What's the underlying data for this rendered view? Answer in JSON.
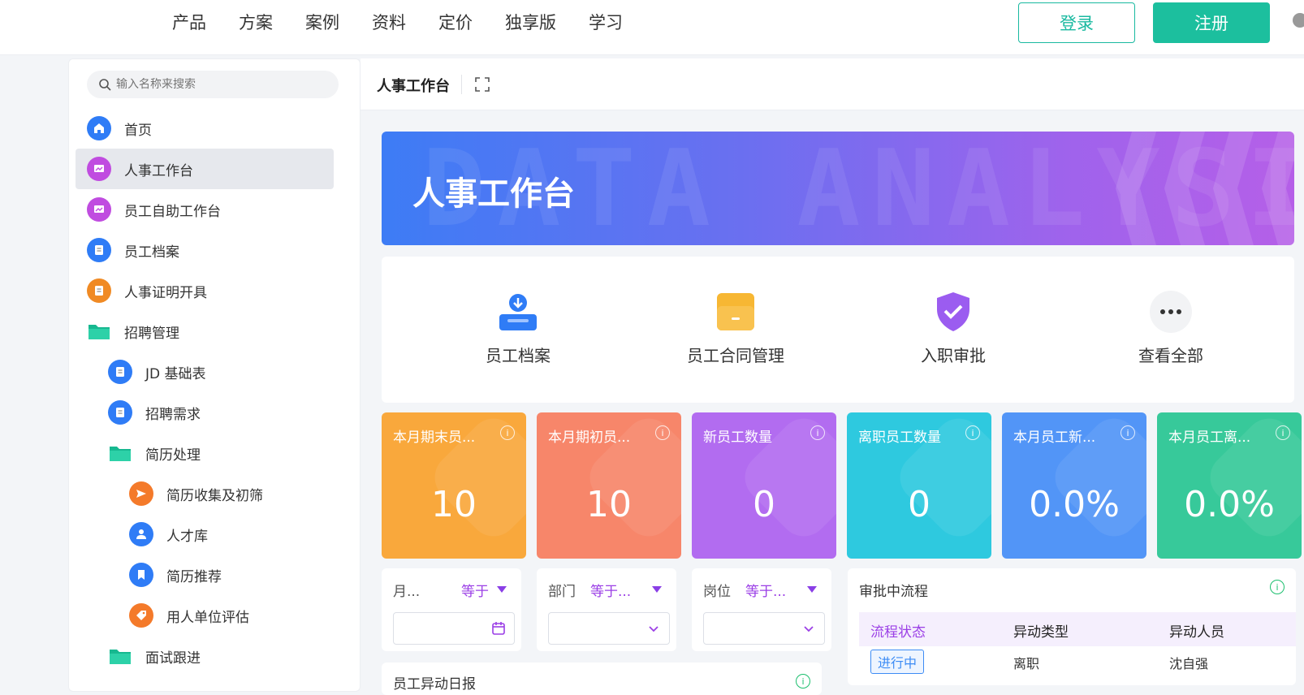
{
  "topnav": {
    "items": [
      "产品",
      "方案",
      "案例",
      "资料",
      "定价",
      "独享版",
      "学习"
    ],
    "login": "登录",
    "register": "注册"
  },
  "sidebar": {
    "search_placeholder": "输入名称来搜索",
    "items": [
      {
        "label": "首页",
        "icon": "home-icon",
        "color": "#2f7cf6"
      },
      {
        "label": "人事工作台",
        "icon": "dashboard-icon",
        "color": "#c04ce0"
      },
      {
        "label": "员工自助工作台",
        "icon": "dashboard-icon",
        "color": "#c04ce0"
      },
      {
        "label": "员工档案",
        "icon": "document-icon",
        "color": "#2f7cf6"
      },
      {
        "label": "人事证明开具",
        "icon": "document-icon",
        "color": "#f08a24"
      },
      {
        "label": "招聘管理",
        "icon": "folder-icon",
        "color": "#17b890"
      },
      {
        "label": "JD 基础表",
        "icon": "document-icon",
        "color": "#2f7cf6"
      },
      {
        "label": "招聘需求",
        "icon": "document-icon",
        "color": "#2f7cf6"
      },
      {
        "label": "简历处理",
        "icon": "folder-icon",
        "color": "#17b890"
      },
      {
        "label": "简历收集及初筛",
        "icon": "send-icon",
        "color": "#f47a2a"
      },
      {
        "label": "人才库",
        "icon": "person-icon",
        "color": "#2f7cf6"
      },
      {
        "label": "简历推荐",
        "icon": "bookmark-icon",
        "color": "#2f7cf6"
      },
      {
        "label": "用人单位评估",
        "icon": "tag-icon",
        "color": "#f47a2a"
      },
      {
        "label": "面试跟进",
        "icon": "folder-icon",
        "color": "#17b890"
      }
    ]
  },
  "main": {
    "title": "人事工作台",
    "banner_title": "人事工作台",
    "banner_bg_text": "DATA ANALYSIS",
    "quick": [
      {
        "label": "员工档案",
        "icon": "employee-file-icon"
      },
      {
        "label": "员工合同管理",
        "icon": "contract-folder-icon"
      },
      {
        "label": "入职审批",
        "icon": "shield-check-icon"
      },
      {
        "label": "查看全部",
        "icon": "more-icon"
      }
    ],
    "stats": [
      {
        "label": "本月期末员...",
        "value": "10",
        "color": "#f9a83c"
      },
      {
        "label": "本月期初员...",
        "value": "10",
        "color": "#f7866a"
      },
      {
        "label": "新员工数量",
        "value": "0",
        "color": "#b26cf0"
      },
      {
        "label": "离职员工数量",
        "value": "0",
        "color": "#2ec9df"
      },
      {
        "label": "本月员工新...",
        "value": "0.0%",
        "color": "#5295f7"
      },
      {
        "label": "本月员工离...",
        "value": "0.0%",
        "color": "#37c99a"
      }
    ],
    "filters": [
      {
        "label": "月...",
        "op": "等于",
        "kind": "date"
      },
      {
        "label": "部门",
        "op": "等于...",
        "kind": "select"
      },
      {
        "label": "岗位",
        "op": "等于...",
        "kind": "select"
      }
    ],
    "approval": {
      "title": "审批中流程",
      "headers": [
        "流程状态",
        "异动类型",
        "异动人员"
      ],
      "row": {
        "status": "进行中",
        "type": "离职",
        "person": "沈自强"
      }
    },
    "report": {
      "title": "员工异动日报"
    }
  }
}
